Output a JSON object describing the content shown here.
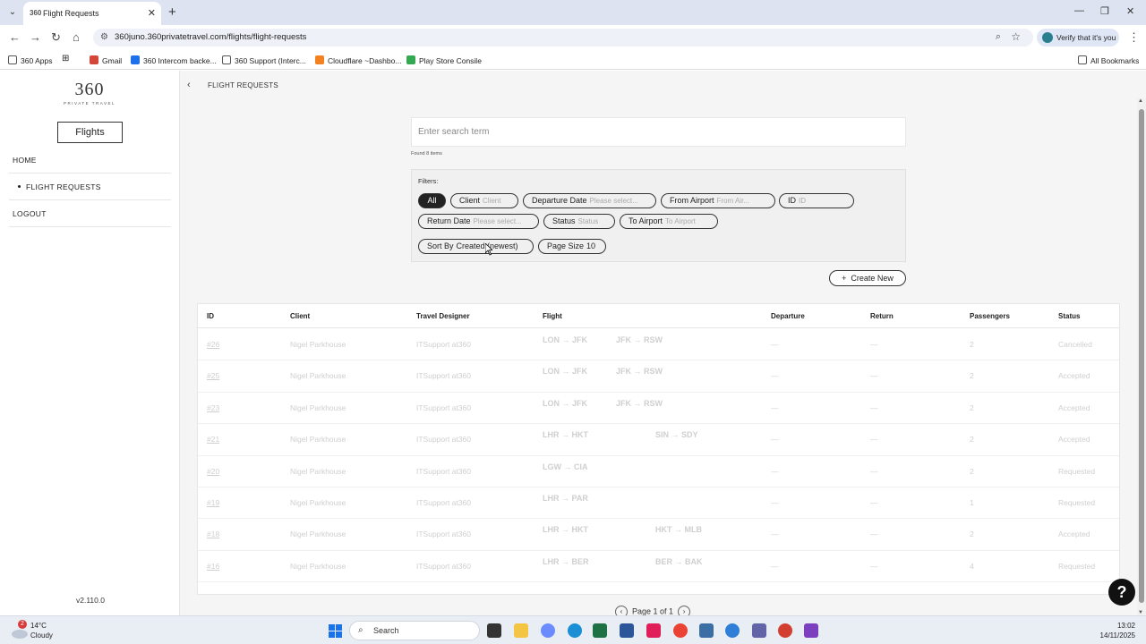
{
  "browser": {
    "tab_title": "Flight Requests",
    "tab_favicon": "360",
    "url": "360juno.360privatetravel.com/flights/flight-requests",
    "verify_label": "Verify that it's you",
    "bookmarks": [
      "360 Apps",
      "Gmail",
      "360 Intercom backe...",
      "360 Support (Interc...",
      "Cloudflare ~Dashbo...",
      "Play Store Consile"
    ],
    "all_bookmarks": "All Bookmarks"
  },
  "sidebar": {
    "logo_number": "360",
    "logo_sub": "PRIVATE TRAVEL",
    "section_button": "Flights",
    "items": [
      {
        "label": "HOME"
      },
      {
        "label": "FLIGHT REQUESTS"
      },
      {
        "label": "LOGOUT"
      }
    ],
    "version": "v2.110.0"
  },
  "page": {
    "breadcrumb": "FLIGHT REQUESTS",
    "search_placeholder": "Enter search term",
    "found": "Found 8 items",
    "filters_label": "Filters:",
    "filters": {
      "all": "All",
      "client": {
        "label": "Client",
        "value": "Client"
      },
      "departure_date": {
        "label": "Departure Date",
        "value": "Please select..."
      },
      "from_airport": {
        "label": "From Airport",
        "value": "From Air..."
      },
      "id": {
        "label": "ID",
        "value": "ID"
      },
      "return_date": {
        "label": "Return Date",
        "value": "Please select..."
      },
      "status": {
        "label": "Status",
        "value": "Status"
      },
      "to_airport": {
        "label": "To Airport",
        "value": "To Airport"
      },
      "sort_by": {
        "label": "Sort By",
        "value": "Created (newest)"
      },
      "page_size": {
        "label": "Page Size",
        "value": "10"
      }
    },
    "create_new": "Create New",
    "pager": "Page 1 of 1"
  },
  "table": {
    "headers": {
      "id": "ID",
      "client": "Client",
      "designer": "Travel Designer",
      "flight": "Flight",
      "departure": "Departure",
      "return": "Return",
      "passengers": "Passengers",
      "status": "Status"
    },
    "rows": [
      {
        "id": "#26",
        "client": "Nigel Parkhouse",
        "designer": "ITSupport at360",
        "leg1": "LON → JFK",
        "leg2": "JFK → RSW",
        "stop": "",
        "departure": "—",
        "return": "—",
        "passengers": "2",
        "status": "Cancelled"
      },
      {
        "id": "#25",
        "client": "Nigel Parkhouse",
        "designer": "ITSupport at360",
        "leg1": "LON → JFK",
        "leg2": "JFK → RSW",
        "stop": "",
        "departure": "—",
        "return": "—",
        "passengers": "2",
        "status": "Accepted"
      },
      {
        "id": "#23",
        "client": "Nigel Parkhouse",
        "designer": "ITSupport at360",
        "leg1": "LON → JFK",
        "leg2": "JFK → RSW",
        "stop": "",
        "departure": "—",
        "return": "—",
        "passengers": "2",
        "status": "Accepted"
      },
      {
        "id": "#21",
        "client": "Nigel Parkhouse",
        "designer": "ITSupport at360",
        "leg1": "LHR → HKT",
        "leg2": "SIN → SDY",
        "stop": "",
        "departure": "—",
        "return": "—",
        "passengers": "2",
        "status": "Accepted"
      },
      {
        "id": "#20",
        "client": "Nigel Parkhouse",
        "designer": "ITSupport at360",
        "leg1": "LGW → CIA",
        "leg2": "",
        "stop": "",
        "departure": "—",
        "return": "—",
        "passengers": "2",
        "status": "Requested"
      },
      {
        "id": "#19",
        "client": "Nigel Parkhouse",
        "designer": "ITSupport at360",
        "leg1": "LHR → PAR",
        "leg2": "",
        "stop": "",
        "departure": "—",
        "return": "—",
        "passengers": "1",
        "status": "Requested"
      },
      {
        "id": "#18",
        "client": "Nigel Parkhouse",
        "designer": "ITSupport at360",
        "leg1": "LHR → HKT",
        "leg2": "HKT → MLB",
        "stop": "",
        "departure": "—",
        "return": "—",
        "passengers": "2",
        "status": "Accepted"
      },
      {
        "id": "#16",
        "client": "Nigel Parkhouse",
        "designer": "ITSupport at360",
        "leg1": "LHR → BER",
        "leg2": "BER → BAK",
        "stop": "",
        "departure": "—",
        "return": "—",
        "passengers": "4",
        "status": "Requested"
      }
    ]
  },
  "taskbar": {
    "badge": "2",
    "temp": "14°C",
    "weather": "Cloudy",
    "search": "Search",
    "time": "13:02",
    "date": "14/11/2025"
  },
  "colors": {
    "accent_dark": "#222222",
    "page_bg": "#f5f5f5",
    "faded_row_text": "#cfcfcf"
  }
}
